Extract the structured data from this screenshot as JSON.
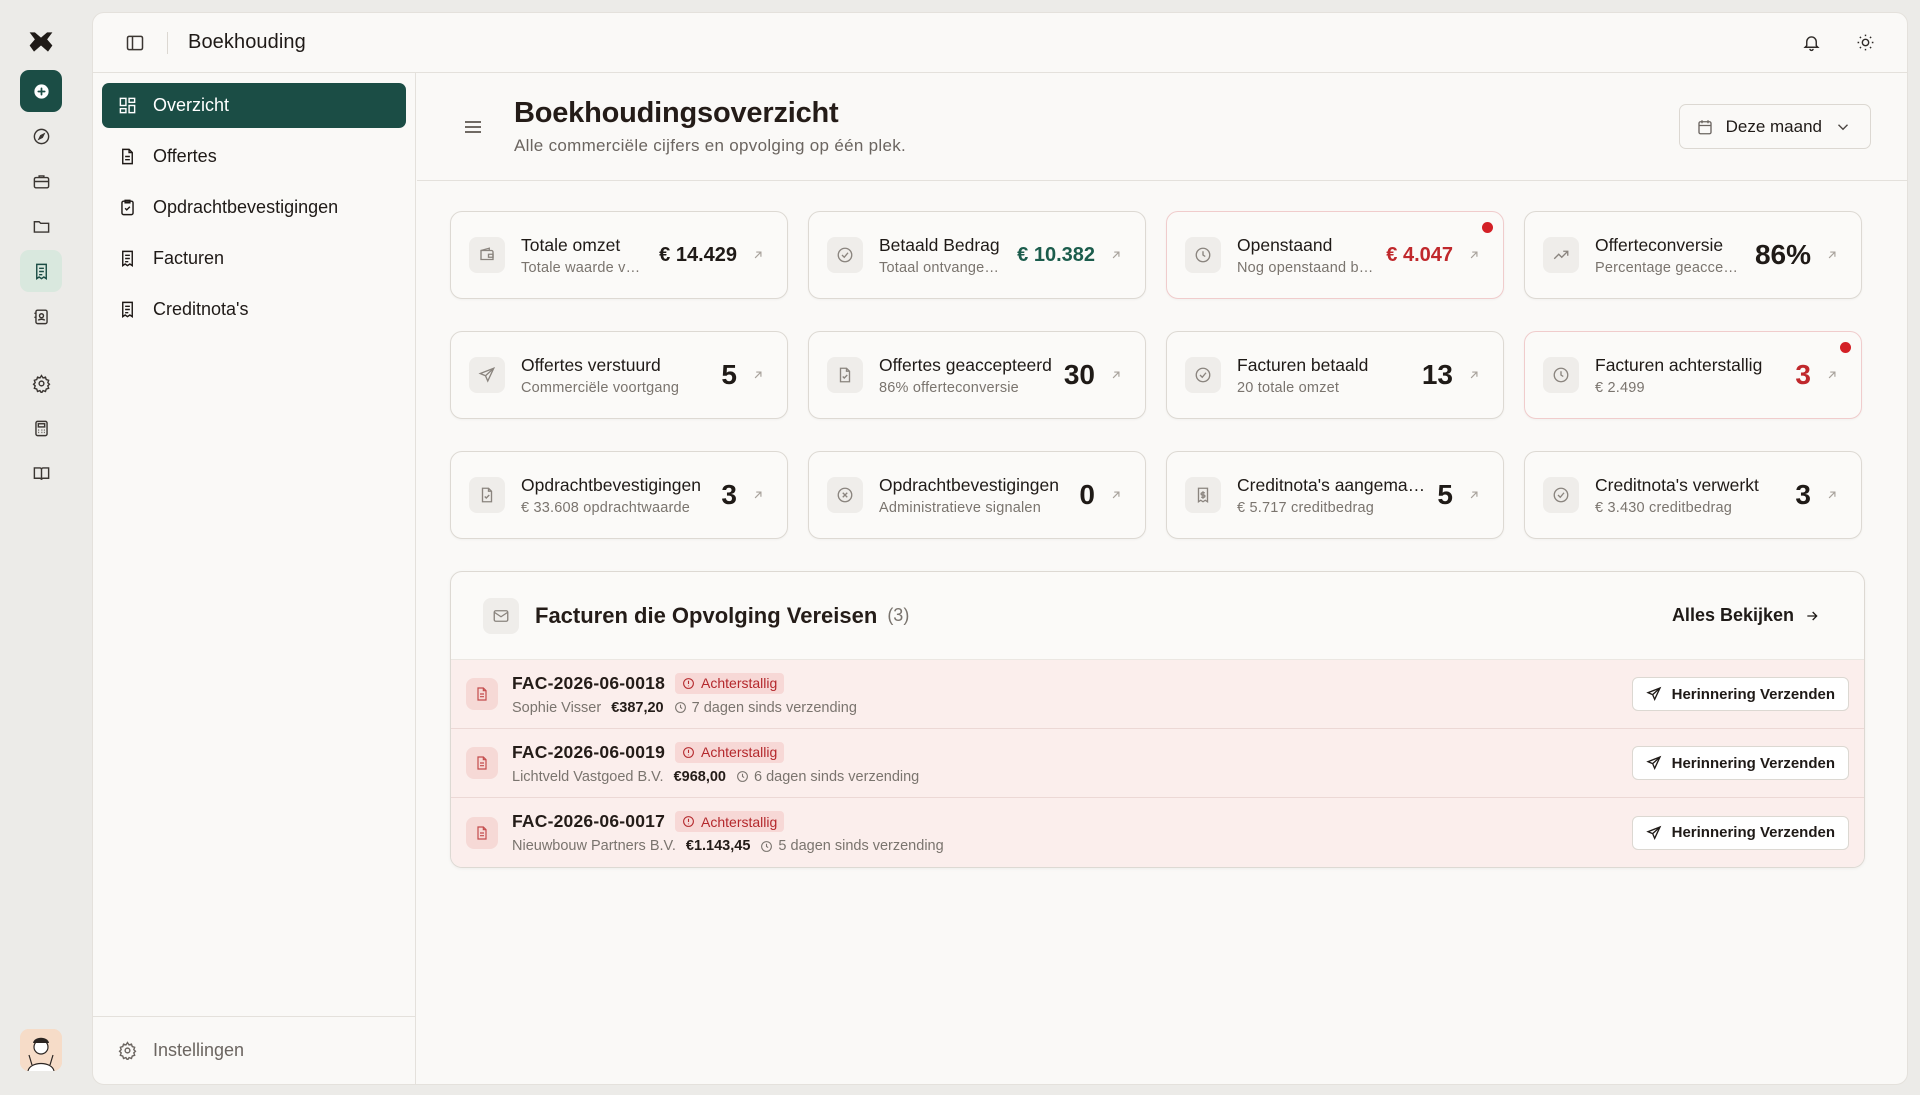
{
  "app": {
    "section_title": "Boekhouding"
  },
  "rail": {
    "items": [
      "add-icon",
      "compass-icon",
      "briefcase-icon",
      "folder-icon",
      "receipt-icon",
      "contacts-icon",
      "settings-icon",
      "calculator-icon",
      "book-icon"
    ],
    "active": "receipt-icon"
  },
  "sidebar": {
    "items": [
      {
        "label": "Overzicht",
        "icon": "grid-icon",
        "active": true
      },
      {
        "label": "Offertes",
        "icon": "document-icon"
      },
      {
        "label": "Opdrachtbevestigingen",
        "icon": "clipboard-check-icon"
      },
      {
        "label": "Facturen",
        "icon": "receipt-icon"
      },
      {
        "label": "Creditnota's",
        "icon": "receipt-icon"
      }
    ],
    "settings_label": "Instellingen"
  },
  "page": {
    "title": "Boekhoudingsoverzicht",
    "subtitle": "Alle commerciële cijfers en opvolging op één plek.",
    "period": "Deze maand"
  },
  "cards": [
    {
      "label": "Totale omzet",
      "hint": "Totale waarde van alle facturen",
      "value": "€ 14.429",
      "tone": "normal",
      "icon": "wallet-icon"
    },
    {
      "label": "Betaald Bedrag",
      "hint": "Totaal ontvangen bedrag",
      "value": "€ 10.382",
      "tone": "green",
      "icon": "check-circle-icon"
    },
    {
      "label": "Openstaand",
      "hint": "Nog openstaand bedrag",
      "value": "€ 4.047",
      "tone": "red",
      "icon": "clock-icon",
      "alert": true
    },
    {
      "label": "Offerteconversie",
      "hint": "Percentage geaccepteerde offertes",
      "value": "86%",
      "tone": "big",
      "icon": "trend-up-icon"
    },
    {
      "label": "Offertes verstuurd",
      "hint": "Commerciële voortgang",
      "value": "5",
      "tone": "big",
      "icon": "send-icon"
    },
    {
      "label": "Offertes geaccepteerd",
      "hint": "86% offerteconversie",
      "value": "30",
      "tone": "big",
      "icon": "file-check-icon"
    },
    {
      "label": "Facturen betaald",
      "hint": "20 totale omzet",
      "value": "13",
      "tone": "big",
      "icon": "check-circle-icon"
    },
    {
      "label": "Facturen achterstallig",
      "hint": "€ 2.499",
      "value": "3",
      "tone": "big-red",
      "icon": "clock-icon",
      "alert": true
    },
    {
      "label": "Opdrachtbevestigingen",
      "hint": "€ 33.608 opdrachtwaarde",
      "value": "3",
      "tone": "big",
      "icon": "file-check-icon"
    },
    {
      "label": "Opdrachtbevestigingen",
      "hint": "Administratieve signalen",
      "value": "0",
      "tone": "big",
      "icon": "x-circle-icon"
    },
    {
      "label": "Creditnota's aangemaakt",
      "hint": "€ 5.717 creditbedrag",
      "value": "5",
      "tone": "big",
      "icon": "receipt-dollar-icon"
    },
    {
      "label": "Creditnota's verwerkt",
      "hint": "€ 3.430 creditbedrag",
      "value": "3",
      "tone": "big",
      "icon": "check-circle-icon"
    }
  ],
  "followup": {
    "title": "Facturen die Opvolging Vereisen",
    "count": "(3)",
    "view_all": "Alles Bekijken",
    "badge_label": "Achterstallig",
    "action_label": "Herinnering Verzenden",
    "rows": [
      {
        "number": "FAC-2026-06-0018",
        "client": "Sophie Visser",
        "amount": "€387,20",
        "since": "7 dagen sinds verzending"
      },
      {
        "number": "FAC-2026-06-0019",
        "client": "Lichtveld Vastgoed B.V.",
        "amount": "€968,00",
        "since": "6 dagen sinds verzending"
      },
      {
        "number": "FAC-2026-06-0017",
        "client": "Nieuwbouw Partners B.V.",
        "amount": "€1.143,45",
        "since": "5 dagen sinds verzending"
      }
    ]
  },
  "colors": {
    "brand": "#1b4d45",
    "positive": "#1b5c4c",
    "negative": "#c0282c",
    "alert_dot": "#d32026",
    "row_alert_bg": "#fbeeec"
  }
}
